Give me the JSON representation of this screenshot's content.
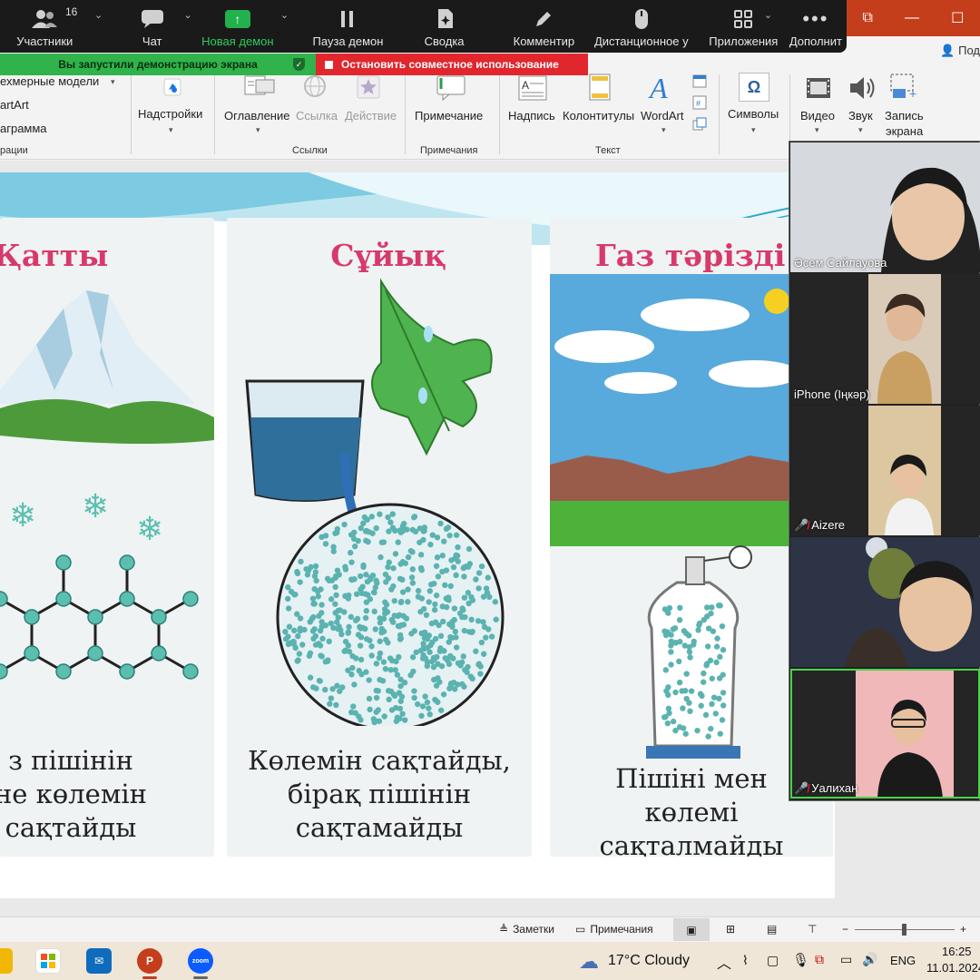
{
  "zoom_toolbar": {
    "participants_count": "16",
    "items": [
      {
        "label": "Участники"
      },
      {
        "label": "Чат"
      },
      {
        "label": "Новая демон"
      },
      {
        "label": "Пауза демон"
      },
      {
        "label": "Сводка"
      },
      {
        "label": "Комментир"
      },
      {
        "label": "Дистанционное у"
      },
      {
        "label": "Приложения"
      },
      {
        "label": "Дополнит"
      }
    ]
  },
  "share_bar": {
    "status": "Вы запустили демонстрацию экрана",
    "stop": "Остановить совместное использование"
  },
  "powerpoint": {
    "share_label": "Под"
  },
  "ribbon": {
    "partial_items": [
      "ехмерные модели",
      "artArt",
      "аграмма"
    ],
    "partial_group": "рации",
    "addins": "Надстройки",
    "links_group": {
      "toc": "Оглавление",
      "link": "Ссылка",
      "action": "Действие",
      "name": "Ссылки"
    },
    "comments_group": {
      "comment": "Примечание",
      "name": "Примечания"
    },
    "text_group": {
      "textbox": "Надпись",
      "headerfooter": "Колонтитулы",
      "wordart": "WordArt",
      "name": "Текст"
    },
    "symbols": "Символы",
    "video": "Видео",
    "audio": "Звук",
    "screen_rec_1": "Запись",
    "screen_rec_2": "экрана"
  },
  "slide": {
    "panels": [
      {
        "title": "Қатты",
        "caption_lines": [
          "з пішінін",
          "не көлемін",
          "сақтайды"
        ]
      },
      {
        "title": "Сұйық",
        "caption_lines": [
          "Көлемін сақтайды,",
          "бірақ пішінін",
          "сақтамайды"
        ]
      },
      {
        "title": "Газ тәрізді",
        "caption_lines": [
          "Пішіні мен",
          "көлемі",
          "сақталмайды"
        ]
      }
    ]
  },
  "participants": [
    {
      "name": "Әсем Сайлауова",
      "muted": false
    },
    {
      "name": "iPhone (Іңкәр)",
      "muted": false
    },
    {
      "name": "Aizere",
      "muted": true
    },
    {
      "name": "",
      "muted": false
    },
    {
      "name": "Уалихан",
      "muted": true
    }
  ],
  "status_bar": {
    "notes": "Заметки",
    "comments": "Примечания"
  },
  "taskbar": {
    "weather": "17°C Cloudy",
    "lang": "ENG",
    "time": "16:25",
    "date": "11.01.2024"
  }
}
